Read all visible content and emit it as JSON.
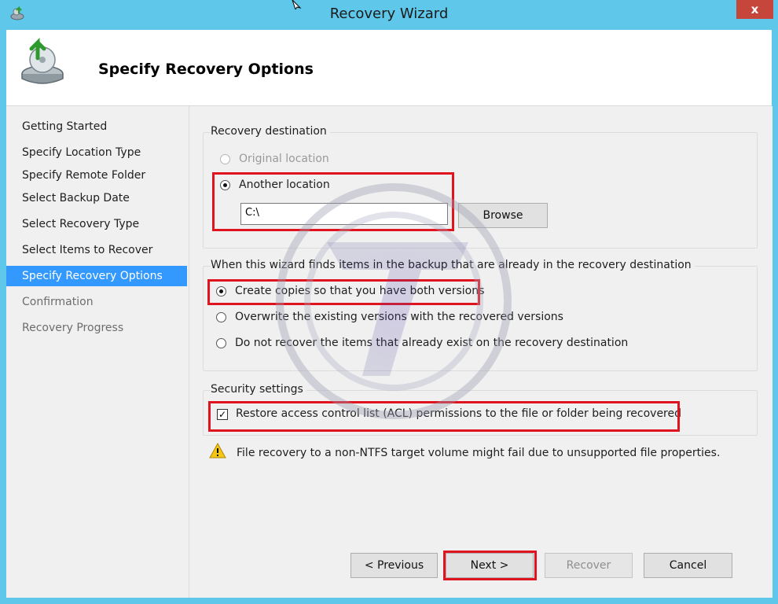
{
  "window": {
    "title": "Recovery Wizard",
    "close_glyph": "x"
  },
  "header": {
    "title": "Specify Recovery Options",
    "icon": "backup-recovery-icon"
  },
  "nav": {
    "items": [
      {
        "label": "Getting Started"
      },
      {
        "label": "Specify Location Type"
      },
      {
        "label": "Specify Remote Folder"
      },
      {
        "label": "Select Backup Date"
      },
      {
        "label": "Select Recovery Type"
      },
      {
        "label": "Select Items to Recover"
      },
      {
        "label": "Specify Recovery Options"
      },
      {
        "label": "Confirmation"
      },
      {
        "label": "Recovery Progress"
      }
    ],
    "active_index": 6
  },
  "destination": {
    "group_label": "Recovery destination",
    "original_label": "Original location",
    "another_label": "Another location",
    "path_value": "C:\\",
    "browse_label": "Browse"
  },
  "conflict": {
    "group_label": "When this wizard finds items in the backup that are already in the recovery destination",
    "options": [
      {
        "label": "Create copies so that you have both versions",
        "checked": true
      },
      {
        "label": "Overwrite the existing versions with the recovered versions",
        "checked": false
      },
      {
        "label": "Do not recover the items that already exist on the recovery destination",
        "checked": false
      }
    ]
  },
  "security": {
    "group_label": "Security settings",
    "acl_label": "Restore access control list (ACL) permissions to the file or folder being recovered",
    "acl_checked": true
  },
  "warning": {
    "text": "File recovery to a non-NTFS target volume might fail due to unsupported file properties.",
    "icon": "warning-icon"
  },
  "buttons": {
    "previous": "< Previous",
    "next": "Next >",
    "recover": "Recover",
    "cancel": "Cancel"
  },
  "colors": {
    "titlebar": "#5ec7ea",
    "active_nav": "#3399ff",
    "highlight_frame": "#e0141e",
    "close_button": "#c7463b"
  }
}
